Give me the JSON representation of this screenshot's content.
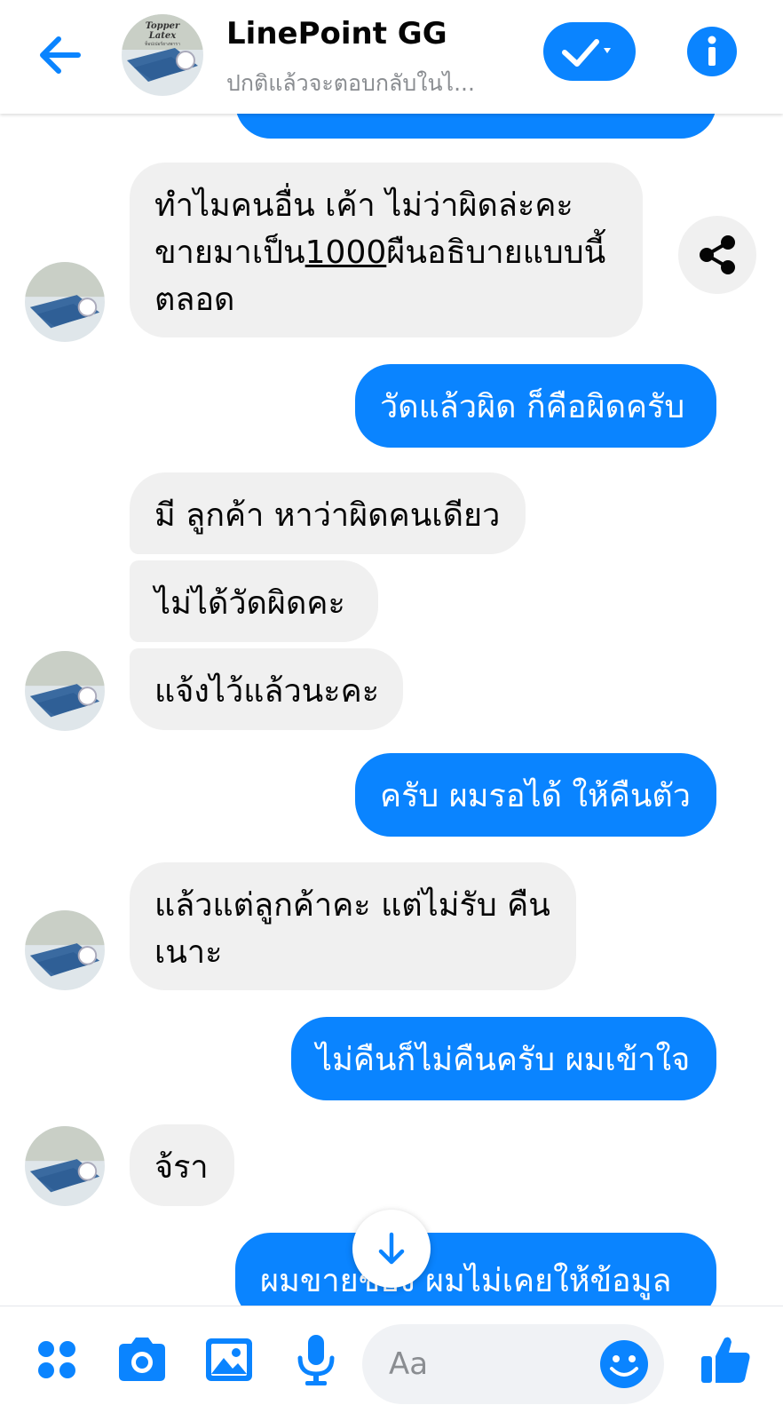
{
  "header": {
    "title": "LinePoint GG",
    "subtitle": "ปกติแล้วจะตอบกลับในไ..."
  },
  "messages": [
    {
      "side": "in",
      "lines": [
        "ทำไมคนอื่น เค้า ไม่ว่าผิดล่ะคะ"
      ]
    },
    {
      "side": "in",
      "line2_pre": "ขายมาเป็น",
      "line2_num": "1000",
      "line2_post": "ผืนอธิบายแบบนี้",
      "line3": "ตลอด"
    },
    {
      "side": "out",
      "text": "วัดแล้วผิด ก็คือผิดครับ"
    },
    {
      "side": "in",
      "text": "มี ลูกค้า หาว่าผิดคนเดียว"
    },
    {
      "side": "in",
      "text": "ไม่ได้วัดผิดคะ"
    },
    {
      "side": "in",
      "text": "แจ้งไว้แล้วนะคะ"
    },
    {
      "side": "out",
      "text": "ครับ ผมรอได้ ให้คืนตัว"
    },
    {
      "side": "in",
      "line1": "แล้วแต่ลูกค้าคะ แต่ไม่รับ คืน",
      "line2": "เนาะ"
    },
    {
      "side": "out",
      "text": "ไม่คืนก็ไม่คืนครับ ผมเข้าใจ"
    },
    {
      "side": "in",
      "text": "จ้รา"
    },
    {
      "side": "out",
      "text": "ผมขายของ ผมไม่เคยให้ข้อมูล"
    }
  ],
  "avatar": {
    "line1": "Topper",
    "line2": "Latex",
    "line3": "ท็อปเปอร์ยางพารา"
  },
  "composer": {
    "placeholder": "Aa"
  },
  "colors": {
    "accent": "#0a84ff",
    "incoming_bubble": "#f0f0f0",
    "outgoing_bubble": "#0a84ff"
  },
  "icons": [
    "back-arrow-icon",
    "checkmark-dropdown-icon",
    "info-icon",
    "share-icon",
    "arrow-down-icon",
    "apps-grid-icon",
    "camera-icon",
    "image-icon",
    "microphone-icon",
    "emoji-icon",
    "thumbs-up-icon"
  ]
}
